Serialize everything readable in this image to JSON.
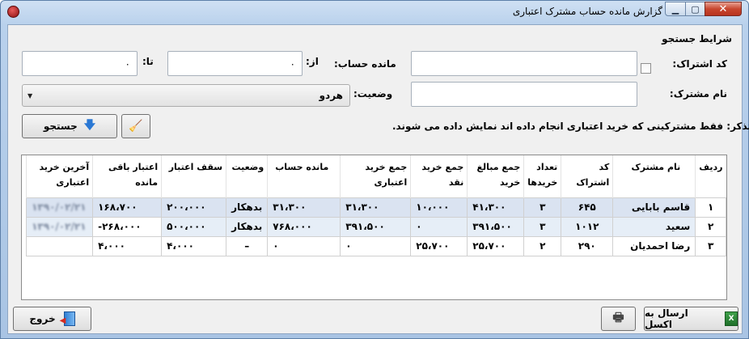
{
  "window": {
    "title": "گزارش مانده حساب مشترک اعتباری"
  },
  "search": {
    "group_title": "شرایط جستجو",
    "subscriber_code_label": "کد اشتراک:",
    "subscriber_name_label": "نام مشترک:",
    "balance_label": "مانده حساب:",
    "from_label": "از:",
    "to_label": "تا:",
    "from_value": "۰",
    "to_value": "۰",
    "status_label": "وضعیت:",
    "status_value": "هردو",
    "search_button": "جستجو",
    "note": "تذکر: فقط مشترکینی که خرید اعتباری انجام داده اند نمایش داده می شوند."
  },
  "table": {
    "headers": [
      "ردیف",
      "نام مشترک",
      "کد اشتراک",
      "تعداد خریدها",
      "جمع مبالغ خرید",
      "جمع خرید نقد",
      "جمع خرید اعتباری",
      "مانده حساب",
      "وضعیت",
      "سقف اعتبار",
      "اعتبار باقی مانده",
      "آخرین خرید اعتباری"
    ],
    "rows": [
      [
        "۱",
        "قاسم بابایی",
        "۶۴۵",
        "۳",
        "۴۱،۳۰۰",
        "۱۰،۰۰۰",
        "۳۱،۳۰۰",
        "۳۱،۳۰۰",
        "بدهکار",
        "۲۰۰،۰۰۰",
        "۱۶۸،۷۰۰",
        "۱۳۹۰/۰۲/۲۱"
      ],
      [
        "۲",
        "سعید",
        "۱۰۱۲",
        "۳",
        "۳۹۱،۵۰۰",
        "۰",
        "۳۹۱،۵۰۰",
        "۷۶۸،۰۰۰",
        "بدهکار",
        "۵۰۰،۰۰۰",
        "-۲۶۸،۰۰۰",
        "۱۳۹۰/۰۲/۲۱"
      ],
      [
        "۳",
        "رضا احمدیان",
        "۲۹۰",
        "۲",
        "۲۵،۷۰۰",
        "۲۵،۷۰۰",
        "۰",
        "۰",
        "–",
        "۴،۰۰۰",
        "۴،۰۰۰",
        ""
      ]
    ]
  },
  "footer": {
    "excel_button": "ارسال به اکسل",
    "exit_button": "خروج"
  },
  "colors": {
    "title_bar": "#b9d1ec",
    "selection": "#dae3f1",
    "close_button": "#c8462f"
  }
}
